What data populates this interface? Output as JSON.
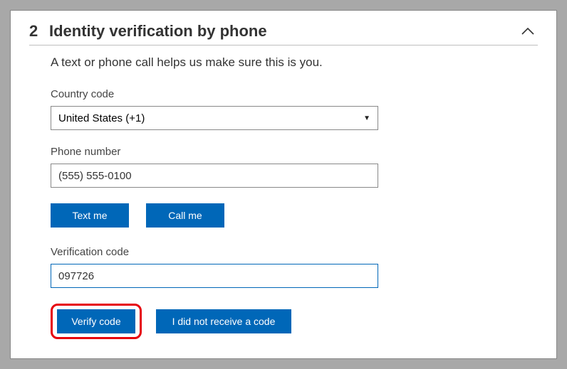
{
  "step": {
    "number": "2",
    "title": "Identity verification by phone"
  },
  "subtitle": "A text or phone call helps us make sure this is you.",
  "country": {
    "label": "Country code",
    "selected": "United States (+1)"
  },
  "phone": {
    "label": "Phone number",
    "value": "(555) 555-0100"
  },
  "actions": {
    "text_me": "Text me",
    "call_me": "Call me"
  },
  "verification": {
    "label": "Verification code",
    "value": "097726"
  },
  "verify": {
    "button": "Verify code",
    "resend": "I did not receive a code"
  },
  "colors": {
    "accent": "#0067b8",
    "highlight": "#e6000d"
  }
}
